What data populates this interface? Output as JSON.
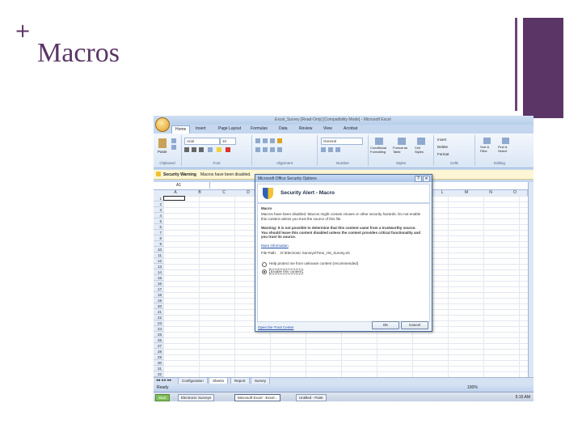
{
  "slide": {
    "plus": "+",
    "title": "Macros"
  },
  "excel": {
    "window_title": "Excel_Survey [Read-Only] [Compatibility Mode] - Microsoft Excel",
    "tabs": [
      "Home",
      "Insert",
      "Page Layout",
      "Formulas",
      "Data",
      "Review",
      "View",
      "Acrobat"
    ],
    "ribbon": {
      "paste": "Paste",
      "font_name": "Arial",
      "font_size": "10",
      "number_format": "General",
      "conditional_formatting": "Conditional Formatting",
      "format_as_table": "Format as Table",
      "cell_styles": "Cell Styles",
      "insert": "Insert",
      "delete": "Delete",
      "format": "Format",
      "sort_filter": "Sort & Filter",
      "find_select": "Find & Select",
      "groups": [
        "Clipboard",
        "Font",
        "Alignment",
        "Number",
        "Styles",
        "Cells",
        "Editing"
      ]
    },
    "security_bar": {
      "label": "Security Warning",
      "message": "Macros have been disabled."
    },
    "name_box": "A1",
    "columns": [
      "A",
      "B",
      "C",
      "D",
      "E",
      "F",
      "G",
      "H",
      "I",
      "J",
      "K",
      "L",
      "M",
      "N",
      "O"
    ],
    "rows": [
      "1",
      "2",
      "3",
      "4",
      "5",
      "6",
      "7",
      "8",
      "9",
      "10",
      "11",
      "12",
      "13",
      "14",
      "15",
      "16",
      "17",
      "18",
      "19",
      "20",
      "21",
      "22",
      "23",
      "24",
      "25",
      "26",
      "27",
      "28",
      "29",
      "30",
      "31",
      "32"
    ],
    "sheet_tabs": [
      "Configuration",
      "Sheet1",
      "Report",
      "Survey"
    ],
    "status": "Ready",
    "zoom": "100%"
  },
  "dialog": {
    "title": "Microsoft Office Security Options",
    "help": "?",
    "close": "✕",
    "header": "Security Alert - Macro",
    "section": "Macro",
    "line1": "Macros have been disabled. Macros might contain viruses or other security hazards. Do not enable this content unless you trust the source of this file.",
    "warning_bold": "Warning: It is not possible to determine that this content came from a trustworthy source. You should leave this content disabled unless the content provides critical functionality and you trust its source.",
    "more_info": "More information",
    "file_path_label": "File Path:",
    "file_path": "D:\\Electronic Surveys\\Time_HS_Survey.xls",
    "option1": "Help protect me from unknown content (recommended)",
    "option2": "Enable this content",
    "trust_center": "Open the Trust Center",
    "ok": "OK",
    "cancel": "Cancel"
  },
  "taskbar": {
    "start": "Start",
    "items": [
      "Electronic Surveys",
      "Microsoft Excel - Excel...",
      "Untitled - Paint"
    ],
    "clock": "5:16 AM"
  }
}
